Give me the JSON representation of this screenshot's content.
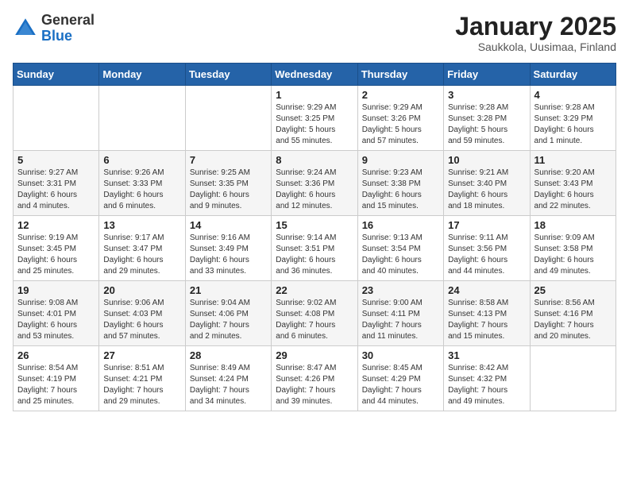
{
  "logo": {
    "general": "General",
    "blue": "Blue"
  },
  "header": {
    "title": "January 2025",
    "subtitle": "Saukkola, Uusimaa, Finland"
  },
  "weekdays": [
    "Sunday",
    "Monday",
    "Tuesday",
    "Wednesday",
    "Thursday",
    "Friday",
    "Saturday"
  ],
  "weeks": [
    [
      {
        "day": "",
        "info": ""
      },
      {
        "day": "",
        "info": ""
      },
      {
        "day": "",
        "info": ""
      },
      {
        "day": "1",
        "info": "Sunrise: 9:29 AM\nSunset: 3:25 PM\nDaylight: 5 hours\nand 55 minutes."
      },
      {
        "day": "2",
        "info": "Sunrise: 9:29 AM\nSunset: 3:26 PM\nDaylight: 5 hours\nand 57 minutes."
      },
      {
        "day": "3",
        "info": "Sunrise: 9:28 AM\nSunset: 3:28 PM\nDaylight: 5 hours\nand 59 minutes."
      },
      {
        "day": "4",
        "info": "Sunrise: 9:28 AM\nSunset: 3:29 PM\nDaylight: 6 hours\nand 1 minute."
      }
    ],
    [
      {
        "day": "5",
        "info": "Sunrise: 9:27 AM\nSunset: 3:31 PM\nDaylight: 6 hours\nand 4 minutes."
      },
      {
        "day": "6",
        "info": "Sunrise: 9:26 AM\nSunset: 3:33 PM\nDaylight: 6 hours\nand 6 minutes."
      },
      {
        "day": "7",
        "info": "Sunrise: 9:25 AM\nSunset: 3:35 PM\nDaylight: 6 hours\nand 9 minutes."
      },
      {
        "day": "8",
        "info": "Sunrise: 9:24 AM\nSunset: 3:36 PM\nDaylight: 6 hours\nand 12 minutes."
      },
      {
        "day": "9",
        "info": "Sunrise: 9:23 AM\nSunset: 3:38 PM\nDaylight: 6 hours\nand 15 minutes."
      },
      {
        "day": "10",
        "info": "Sunrise: 9:21 AM\nSunset: 3:40 PM\nDaylight: 6 hours\nand 18 minutes."
      },
      {
        "day": "11",
        "info": "Sunrise: 9:20 AM\nSunset: 3:43 PM\nDaylight: 6 hours\nand 22 minutes."
      }
    ],
    [
      {
        "day": "12",
        "info": "Sunrise: 9:19 AM\nSunset: 3:45 PM\nDaylight: 6 hours\nand 25 minutes."
      },
      {
        "day": "13",
        "info": "Sunrise: 9:17 AM\nSunset: 3:47 PM\nDaylight: 6 hours\nand 29 minutes."
      },
      {
        "day": "14",
        "info": "Sunrise: 9:16 AM\nSunset: 3:49 PM\nDaylight: 6 hours\nand 33 minutes."
      },
      {
        "day": "15",
        "info": "Sunrise: 9:14 AM\nSunset: 3:51 PM\nDaylight: 6 hours\nand 36 minutes."
      },
      {
        "day": "16",
        "info": "Sunrise: 9:13 AM\nSunset: 3:54 PM\nDaylight: 6 hours\nand 40 minutes."
      },
      {
        "day": "17",
        "info": "Sunrise: 9:11 AM\nSunset: 3:56 PM\nDaylight: 6 hours\nand 44 minutes."
      },
      {
        "day": "18",
        "info": "Sunrise: 9:09 AM\nSunset: 3:58 PM\nDaylight: 6 hours\nand 49 minutes."
      }
    ],
    [
      {
        "day": "19",
        "info": "Sunrise: 9:08 AM\nSunset: 4:01 PM\nDaylight: 6 hours\nand 53 minutes."
      },
      {
        "day": "20",
        "info": "Sunrise: 9:06 AM\nSunset: 4:03 PM\nDaylight: 6 hours\nand 57 minutes."
      },
      {
        "day": "21",
        "info": "Sunrise: 9:04 AM\nSunset: 4:06 PM\nDaylight: 7 hours\nand 2 minutes."
      },
      {
        "day": "22",
        "info": "Sunrise: 9:02 AM\nSunset: 4:08 PM\nDaylight: 7 hours\nand 6 minutes."
      },
      {
        "day": "23",
        "info": "Sunrise: 9:00 AM\nSunset: 4:11 PM\nDaylight: 7 hours\nand 11 minutes."
      },
      {
        "day": "24",
        "info": "Sunrise: 8:58 AM\nSunset: 4:13 PM\nDaylight: 7 hours\nand 15 minutes."
      },
      {
        "day": "25",
        "info": "Sunrise: 8:56 AM\nSunset: 4:16 PM\nDaylight: 7 hours\nand 20 minutes."
      }
    ],
    [
      {
        "day": "26",
        "info": "Sunrise: 8:54 AM\nSunset: 4:19 PM\nDaylight: 7 hours\nand 25 minutes."
      },
      {
        "day": "27",
        "info": "Sunrise: 8:51 AM\nSunset: 4:21 PM\nDaylight: 7 hours\nand 29 minutes."
      },
      {
        "day": "28",
        "info": "Sunrise: 8:49 AM\nSunset: 4:24 PM\nDaylight: 7 hours\nand 34 minutes."
      },
      {
        "day": "29",
        "info": "Sunrise: 8:47 AM\nSunset: 4:26 PM\nDaylight: 7 hours\nand 39 minutes."
      },
      {
        "day": "30",
        "info": "Sunrise: 8:45 AM\nSunset: 4:29 PM\nDaylight: 7 hours\nand 44 minutes."
      },
      {
        "day": "31",
        "info": "Sunrise: 8:42 AM\nSunset: 4:32 PM\nDaylight: 7 hours\nand 49 minutes."
      },
      {
        "day": "",
        "info": ""
      }
    ]
  ]
}
